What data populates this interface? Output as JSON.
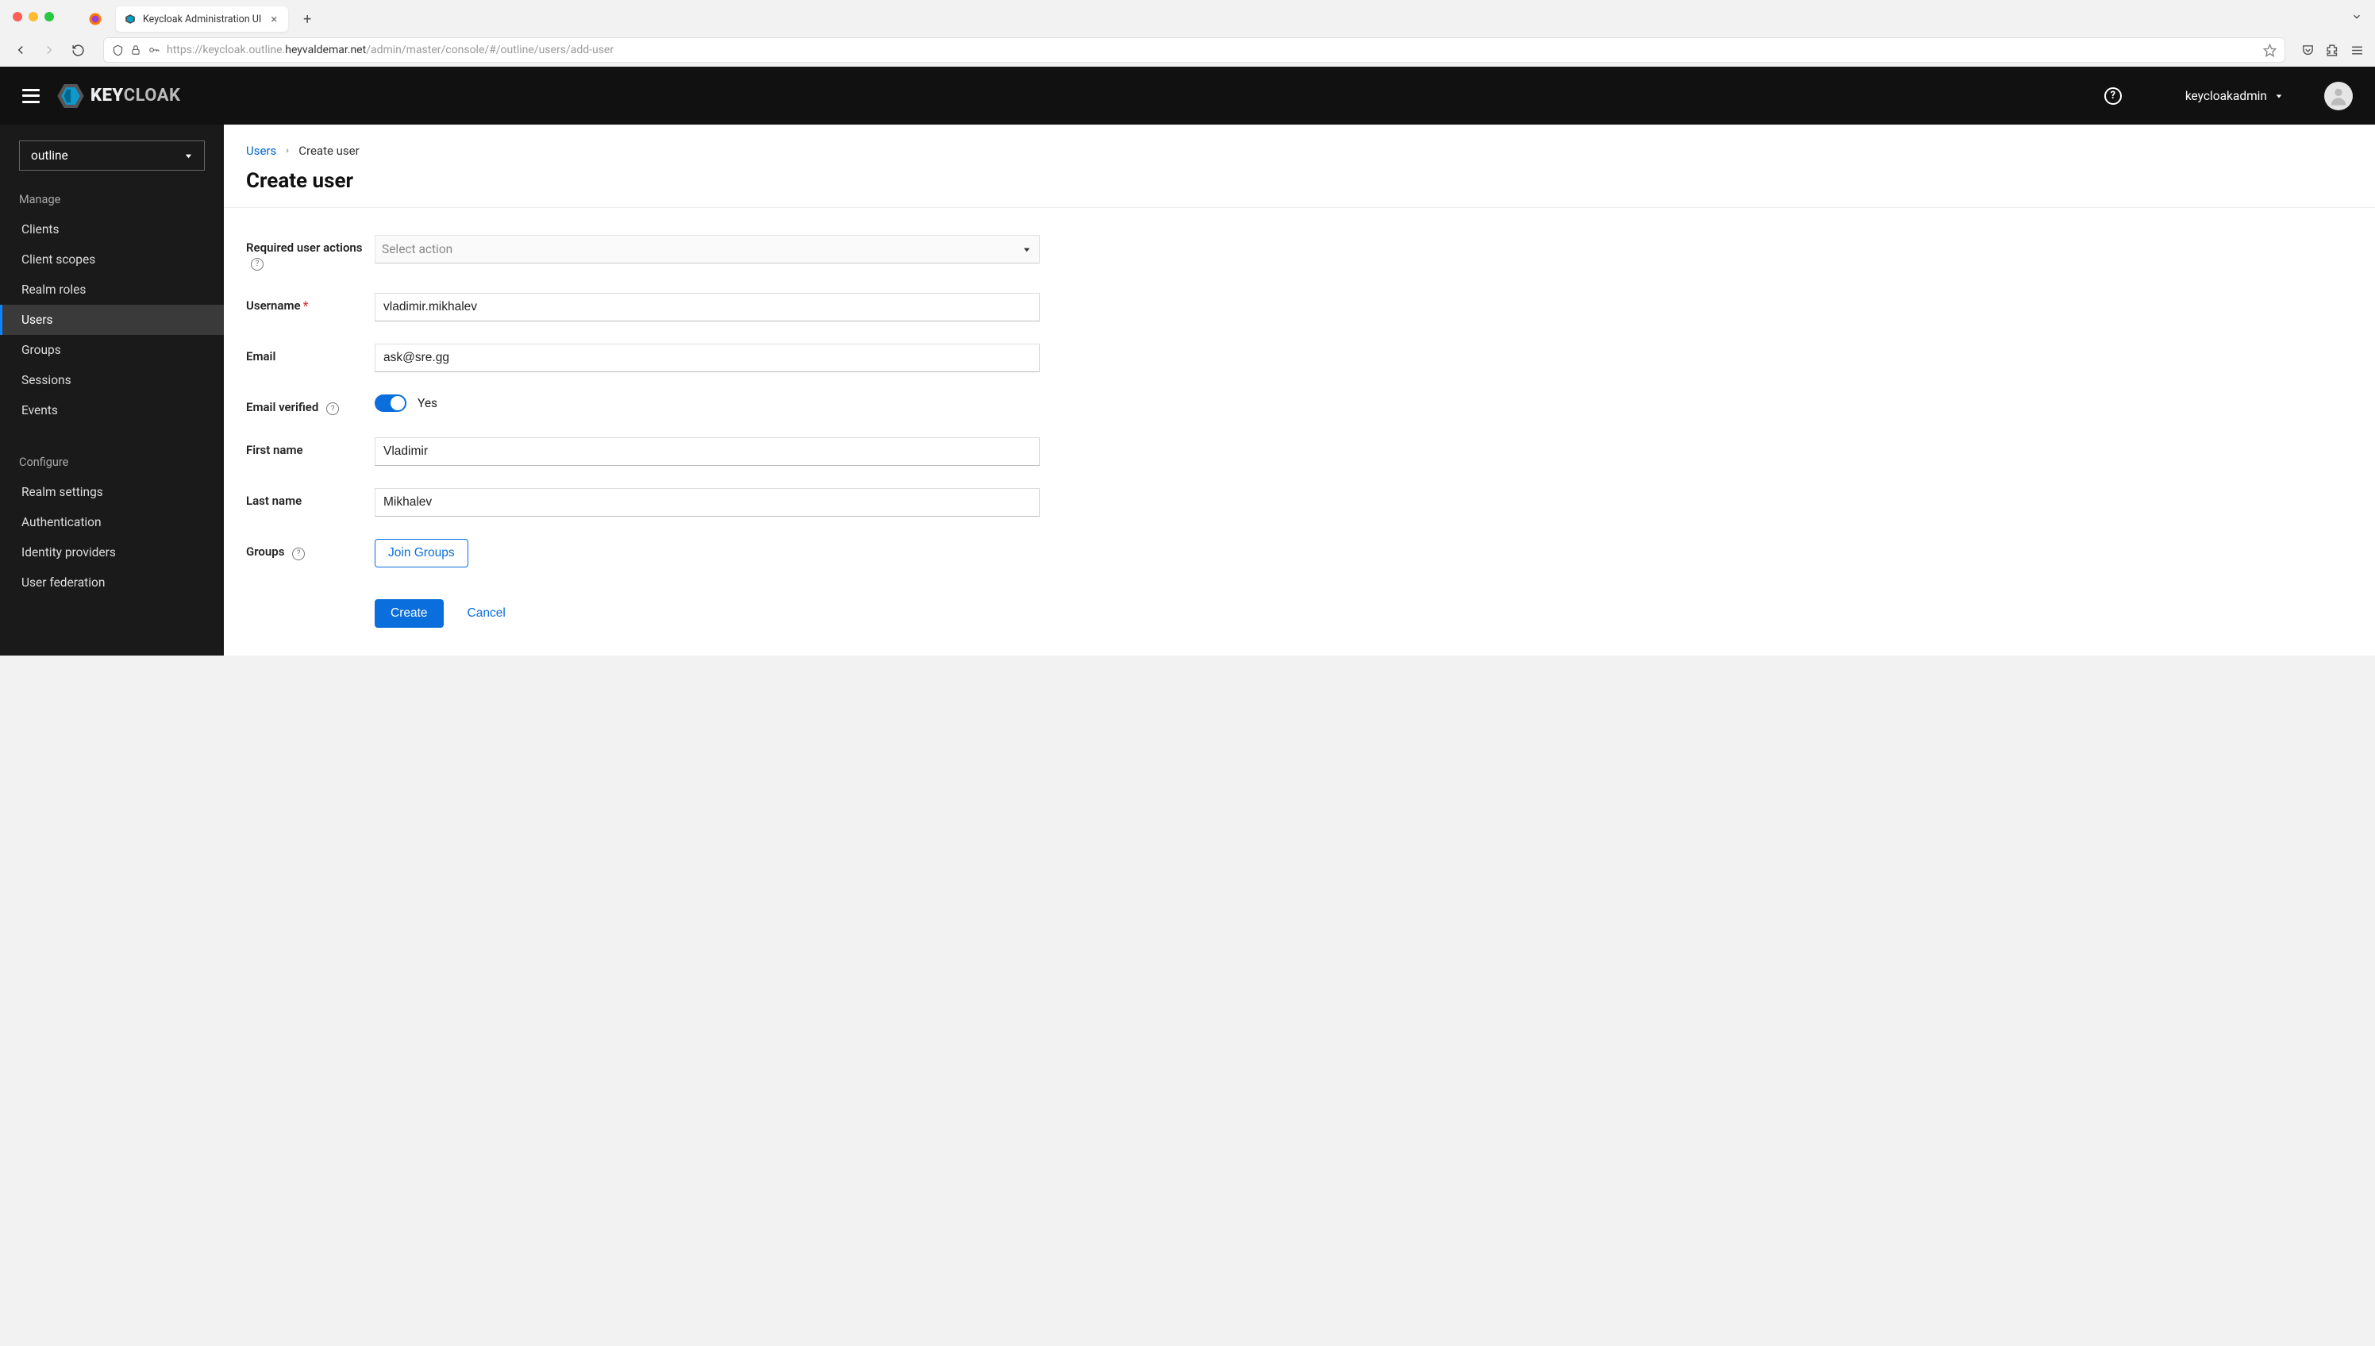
{
  "browser": {
    "tab_title": "Keycloak Administration UI",
    "url_plain1": "https://keycloak.outline.",
    "url_dark": "heyvaldemar.net",
    "url_plain2": "/admin/master/console/#/outline/users/add-user"
  },
  "header": {
    "brand": "KEYCLOAK",
    "username": "keycloakadmin"
  },
  "sidebar": {
    "realm": "outline",
    "section_manage": "Manage",
    "section_configure": "Configure",
    "items_manage": [
      {
        "label": "Clients"
      },
      {
        "label": "Client scopes"
      },
      {
        "label": "Realm roles"
      },
      {
        "label": "Users"
      },
      {
        "label": "Groups"
      },
      {
        "label": "Sessions"
      },
      {
        "label": "Events"
      }
    ],
    "items_configure": [
      {
        "label": "Realm settings"
      },
      {
        "label": "Authentication"
      },
      {
        "label": "Identity providers"
      },
      {
        "label": "User federation"
      }
    ]
  },
  "breadcrumb": {
    "root": "Users",
    "current": "Create user"
  },
  "page": {
    "title": "Create user"
  },
  "form": {
    "required_actions_label": "Required user actions",
    "required_actions_placeholder": "Select action",
    "username_label": "Username",
    "username_value": "vladimir.mikhalev",
    "email_label": "Email",
    "email_value": "ask@sre.gg",
    "email_verified_label": "Email verified",
    "email_verified_value": "Yes",
    "first_name_label": "First name",
    "first_name_value": "Vladimir",
    "last_name_label": "Last name",
    "last_name_value": "Mikhalev",
    "groups_label": "Groups",
    "join_groups_btn": "Join Groups",
    "create_btn": "Create",
    "cancel_btn": "Cancel"
  }
}
